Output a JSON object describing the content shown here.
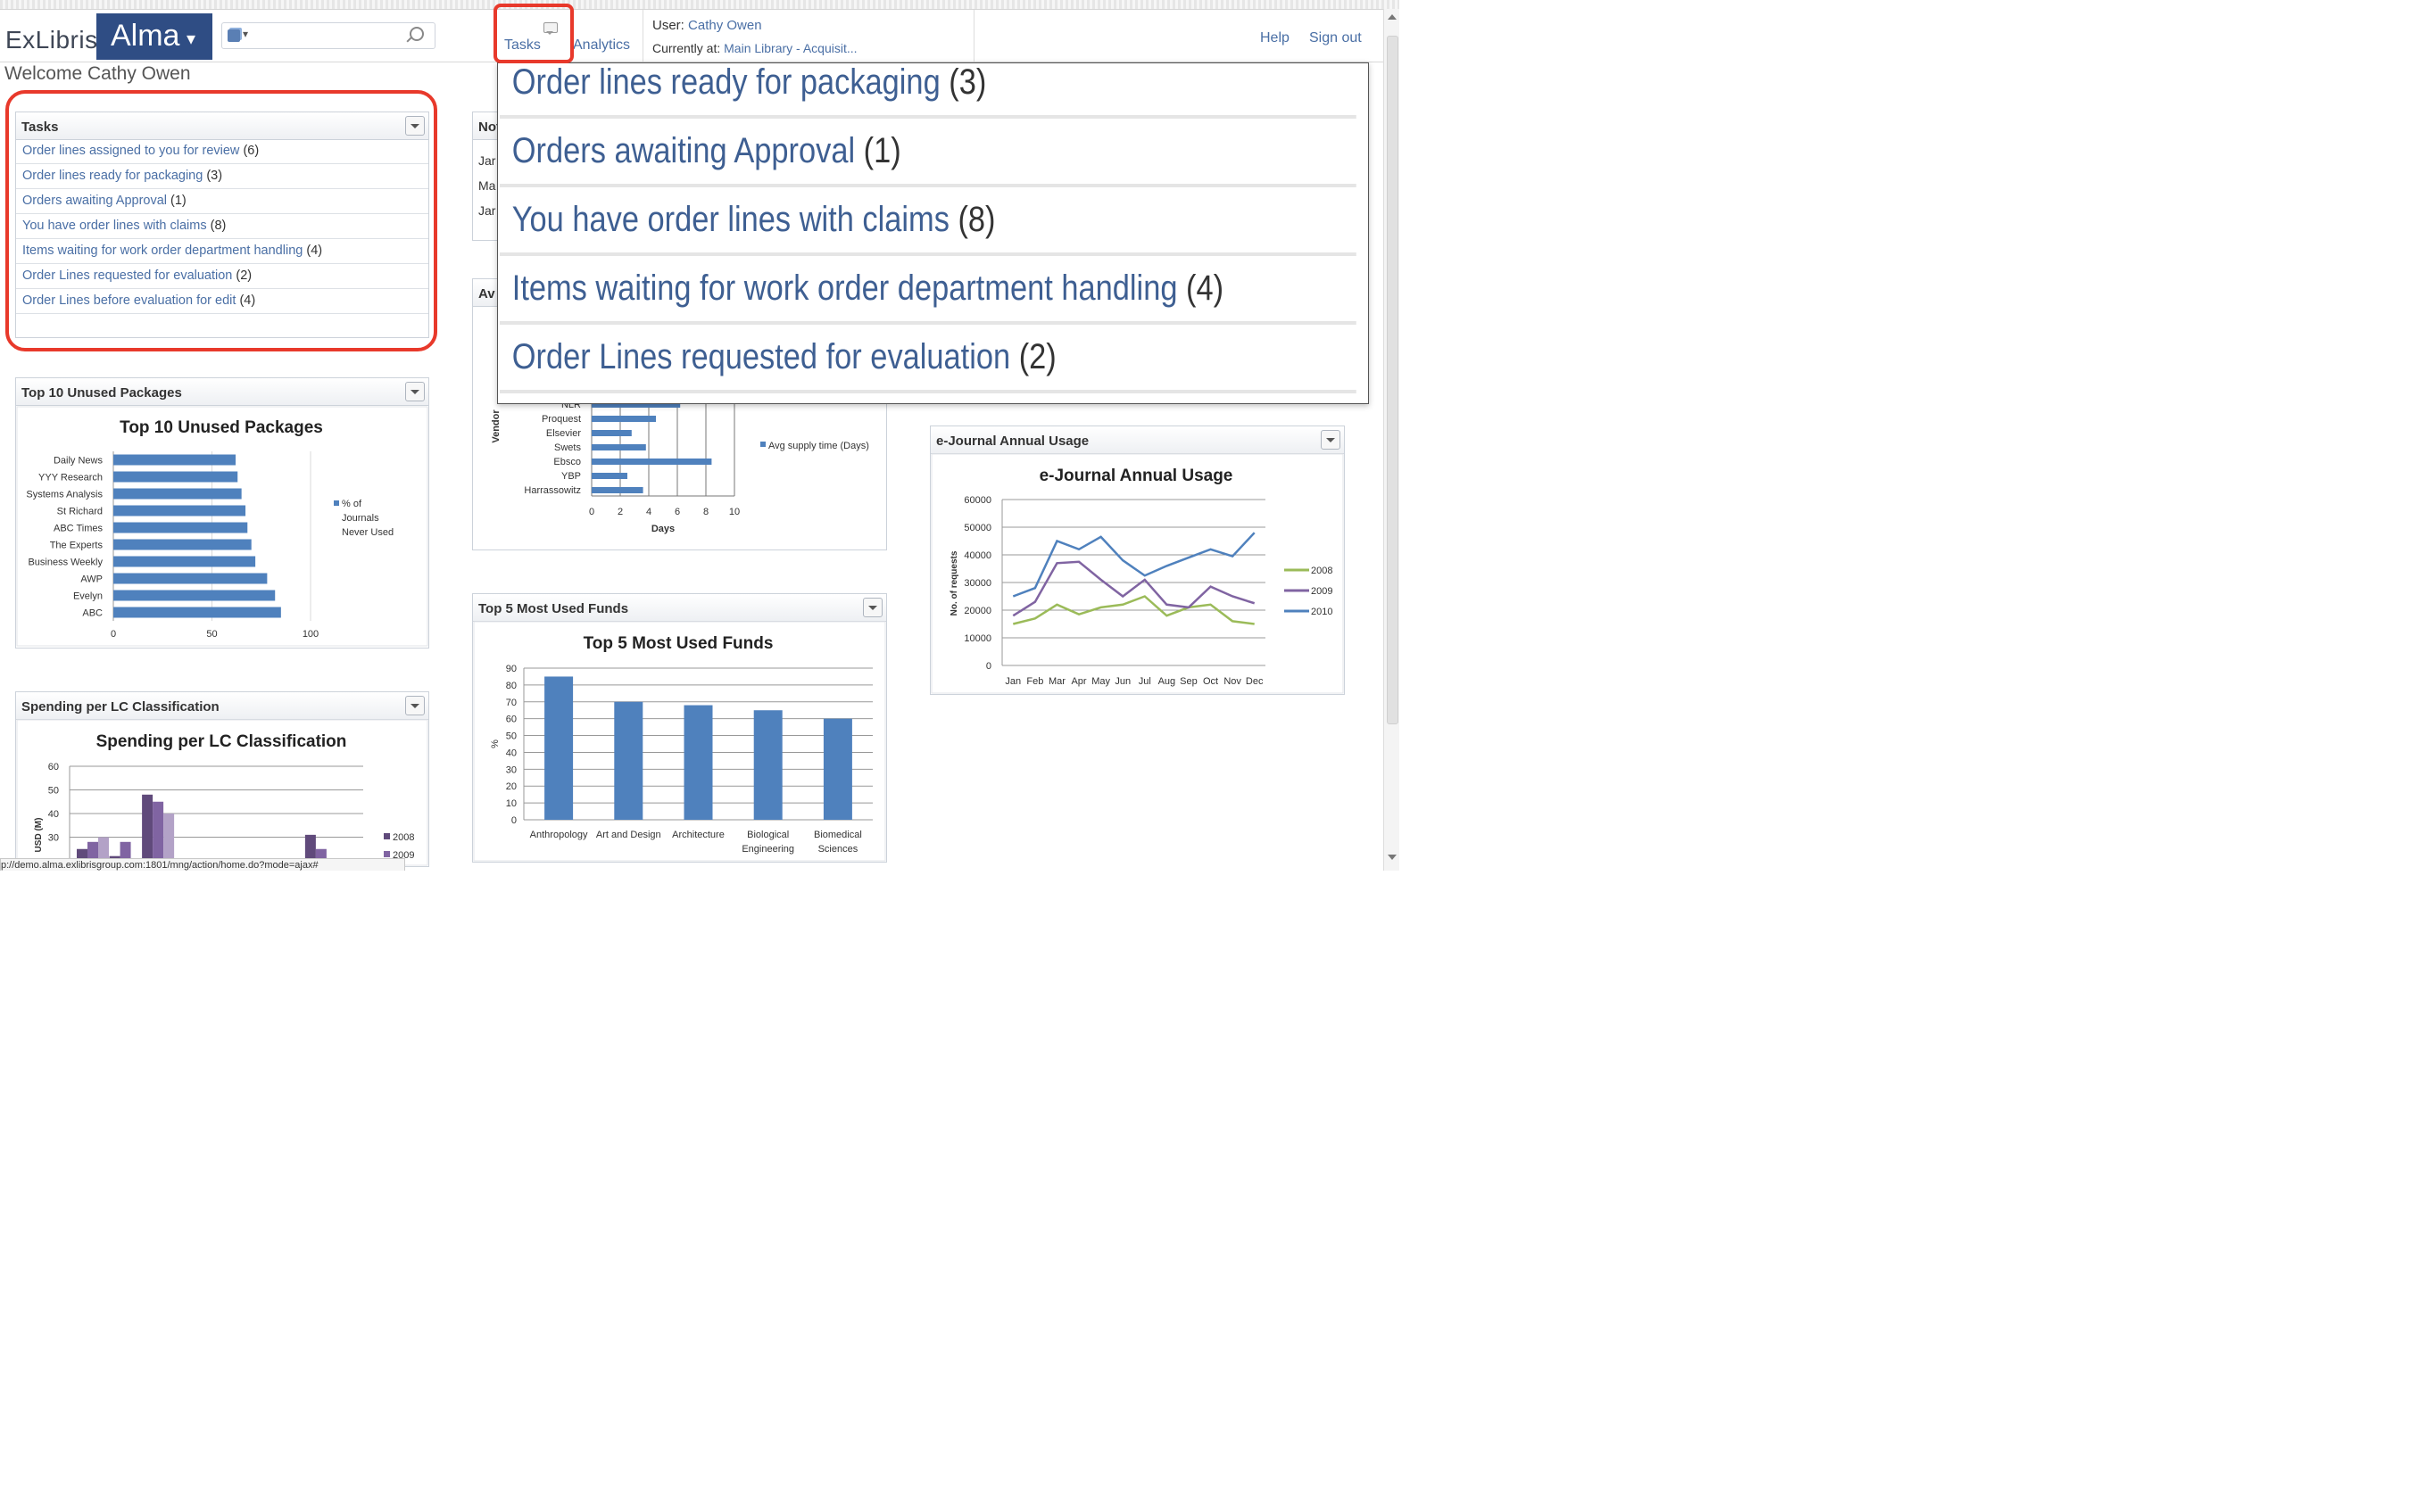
{
  "header": {
    "brand_exlibris": "ExLibris",
    "brand_alma": "Alma",
    "nav_tasks": "Tasks",
    "nav_analytics": "Analytics",
    "user_label": "User:",
    "user_name": "Cathy Owen",
    "location_label": "Currently at:",
    "location_value": "Main Library - Acquisit...",
    "help": "Help",
    "sign_out": "Sign out"
  },
  "welcome": "Welcome Cathy Owen",
  "tasks_widget": {
    "title": "Tasks",
    "items": [
      {
        "label": "Order lines assigned to you for review",
        "count": "(6)"
      },
      {
        "label": "Order lines ready for packaging",
        "count": "(3)"
      },
      {
        "label": "Orders awaiting Approval",
        "count": "(1)"
      },
      {
        "label": "You have order lines with claims",
        "count": "(8)"
      },
      {
        "label": "Items waiting for work order department handling",
        "count": "(4)"
      },
      {
        "label": "Order Lines requested for evaluation",
        "count": "(2)"
      },
      {
        "label": "Order Lines before evaluation for edit",
        "count": "(4)"
      }
    ]
  },
  "tasks_popup": {
    "items": [
      {
        "label": "Order lines ready for packaging",
        "count": "(3)"
      },
      {
        "label": "Orders awaiting Approval",
        "count": "(1)"
      },
      {
        "label": "You have order lines with claims",
        "count": "(8)"
      },
      {
        "label": "Items waiting for work order department handling",
        "count": "(4)"
      },
      {
        "label": "Order Lines requested for evaluation",
        "count": "(2)"
      }
    ]
  },
  "notes_widget": {
    "title_partial": "Not",
    "rows": [
      "Jar",
      "Ma",
      "Jar"
    ]
  },
  "avg_widget": {
    "title_partial": "Av"
  },
  "status_url": "p://demo.alma.exlibrisgroup.com:1801/mng/action/home.do?mode=ajax#",
  "colors": {
    "accent_blue": "#2f4d84",
    "bar_blue": "#4f81bd",
    "highlight_red": "#e8392b",
    "link": "#4a6fa5"
  },
  "chart_data": [
    {
      "id": "unused",
      "type": "bar",
      "orientation": "horizontal",
      "widget_title": "Top 10 Unused Packages",
      "title": "Top 10 Unused Packages",
      "categories": [
        "Daily News",
        "YYY Research",
        "Systems Analysis",
        "St Richard",
        "ABC Times",
        "The Experts",
        "Business Weekly",
        "AWP",
        "Evelyn",
        "ABC"
      ],
      "values": [
        62,
        63,
        65,
        67,
        68,
        70,
        72,
        78,
        82,
        85
      ],
      "xticks": [
        "0",
        "50",
        "100"
      ],
      "xlim": [
        0,
        100
      ],
      "legend": [
        "% of",
        "Journals",
        "Never Used"
      ],
      "legend_position": "right"
    },
    {
      "id": "supply",
      "type": "bar",
      "orientation": "horizontal",
      "categories": [
        "NLR",
        "Proquest",
        "Elsevier",
        "Swets",
        "Ebsco",
        "YBP",
        "Harrassowitz"
      ],
      "values": [
        6.2,
        4.5,
        2.8,
        3.8,
        8.4,
        2.5,
        3.6
      ],
      "xticks": [
        "0",
        "2",
        "4",
        "6",
        "8",
        "10"
      ],
      "xlim": [
        0,
        10
      ],
      "xlabel": "Days",
      "ylabel": "Vendor",
      "legend": "Avg supply time (Days)",
      "legend_position": "right"
    },
    {
      "id": "funds",
      "type": "bar",
      "widget_title": "Top 5 Most Used Funds",
      "title": "Top 5 Most Used Funds",
      "categories": [
        [
          "Anthropology"
        ],
        [
          "Art and Design"
        ],
        [
          "Architecture"
        ],
        [
          "Biological",
          "Engineering"
        ],
        [
          "Biomedical",
          "Sciences"
        ]
      ],
      "values": [
        85,
        70,
        68,
        65,
        60
      ],
      "yticks": [
        "0",
        "10",
        "20",
        "30",
        "40",
        "50",
        "60",
        "70",
        "80",
        "90"
      ],
      "ylim": [
        0,
        90
      ],
      "ylabel": "%"
    },
    {
      "id": "ejournal",
      "type": "line",
      "widget_title": "e-Journal Annual Usage",
      "title": "e-Journal Annual Usage",
      "x": [
        "Jan",
        "Feb",
        "Mar",
        "Apr",
        "May",
        "Jun",
        "Jul",
        "Aug",
        "Sep",
        "Oct",
        "Nov",
        "Dec"
      ],
      "series": [
        {
          "name": "2008",
          "color": "#9bbb59",
          "values": [
            15000,
            17000,
            22000,
            18500,
            21000,
            22000,
            25000,
            18000,
            21000,
            22000,
            16000,
            15000
          ]
        },
        {
          "name": "2009",
          "color": "#8064a2",
          "values": [
            18000,
            23000,
            37000,
            37500,
            31000,
            25000,
            31000,
            22000,
            21000,
            28500,
            25000,
            22500
          ]
        },
        {
          "name": "2010",
          "color": "#4f81bd",
          "values": [
            25000,
            28000,
            45000,
            42000,
            46500,
            38000,
            32500,
            36000,
            39000,
            42000,
            39500,
            48000
          ]
        }
      ],
      "yticks": [
        "0",
        "10000",
        "20000",
        "30000",
        "40000",
        "50000",
        "60000"
      ],
      "ylim": [
        0,
        60000
      ],
      "ylabel": "No. of requests",
      "legend_position": "right"
    },
    {
      "id": "lc",
      "type": "bar",
      "widget_title": "Spending per LC Classification",
      "title": "Spending per LC Classification",
      "groups": 9,
      "series": [
        {
          "name": "2008",
          "color": "#604a7b",
          "values": [
            25,
            22,
            48,
            0,
            0,
            0,
            0,
            31,
            0
          ]
        },
        {
          "name": "2009",
          "color": "#8064a2",
          "values": [
            28,
            28,
            45,
            0,
            0,
            0,
            0,
            25,
            0
          ]
        },
        {
          "name": "",
          "color": "#b3a2c7",
          "values": [
            30,
            0,
            40,
            0,
            0,
            0,
            0,
            0,
            0
          ]
        }
      ],
      "yticks": [
        "30",
        "40",
        "50",
        "60"
      ],
      "ylim": [
        20,
        60
      ],
      "ylabel": "USD (M)",
      "legend": [
        "2008",
        "2009"
      ]
    }
  ]
}
